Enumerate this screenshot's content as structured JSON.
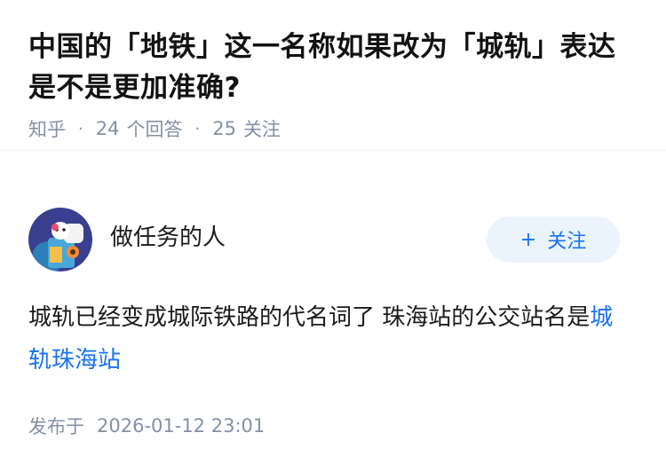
{
  "question": {
    "title": "中国的「地铁」这一名称如果改为「城轨」表达是不是更加准确?",
    "source": "知乎",
    "answers_count": "24",
    "answers_label": "个回答",
    "followers_count": "25",
    "followers_label": "关注"
  },
  "answer": {
    "author_name": "做任务的人",
    "follow_plus": "+",
    "follow_label": "关注",
    "text_prefix": "城轨已经变成城际铁路的代名词了 珠海站的公交站名是",
    "link_text": "城轨珠海站",
    "published_label": "发布于",
    "published_time": "2026-01-12 23:01"
  },
  "colors": {
    "link": "#1772f6",
    "meta": "#8590a6",
    "follow_bg": "#ebf3fc"
  }
}
